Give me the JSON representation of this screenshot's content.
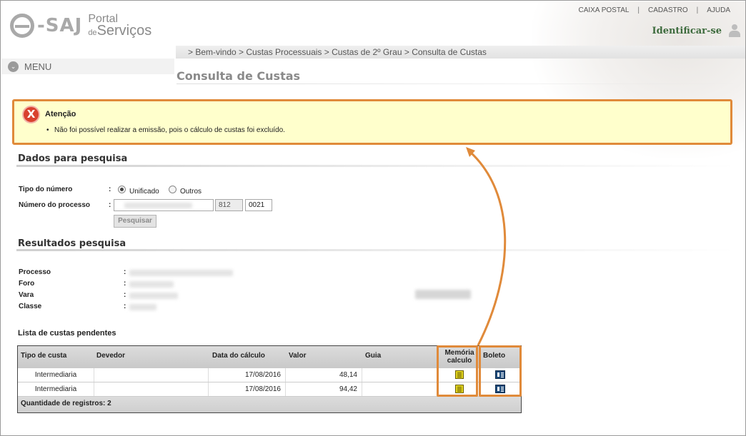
{
  "header": {
    "logo_saj": "-SAJ",
    "logo_portal": "Portal",
    "logo_de": "de",
    "logo_servicos": "Serviços",
    "top_links": [
      "CAIXA POSTAL",
      "CADASTRO",
      "AJUDA"
    ],
    "identify": "Identificar-se"
  },
  "nav": {
    "breadcrumb": "> Bem-vindo > Custas Processuais > Custas de 2º Grau > Consulta de Custas",
    "menu": "MENU",
    "page_title": "Consulta de Custas"
  },
  "alert": {
    "title": "Atenção",
    "message": "Não foi possível realizar a emissão, pois o cálculo de custas foi excluído."
  },
  "search": {
    "section_title": "Dados para pesquisa",
    "tipo_label": "Tipo do número",
    "colon": ":",
    "option_unificado": "Unificado",
    "option_outros": "Outros",
    "selected": "Unificado",
    "numero_label": "Número do processo",
    "field_812": "812",
    "field_0021": "0021",
    "button": "Pesquisar"
  },
  "results": {
    "section_title": "Resultados pesquisa",
    "labels": [
      "Processo",
      "Foro",
      "Vara",
      "Classe"
    ]
  },
  "list": {
    "title": "Lista de custas pendentes",
    "headers": {
      "tipo": "Tipo de custa",
      "devedor": "Devedor",
      "data": "Data do cálculo",
      "valor": "Valor",
      "guia": "Guia",
      "memoria_1": "Memória",
      "memoria_2": "calculo",
      "boleto": "Boleto"
    },
    "rows": [
      {
        "tipo": "Intermediaria",
        "devedor": "",
        "data": "17/08/2016",
        "valor": "48,14",
        "guia": ""
      },
      {
        "tipo": "Intermediaria",
        "devedor": "",
        "data": "17/08/2016",
        "valor": "94,42",
        "guia": ""
      }
    ],
    "footer": "Quantidade de registros: 2"
  },
  "colors": {
    "highlight": "#e08a3a",
    "alert_bg": "#ffffcc",
    "error_icon": "#d9412f",
    "identify": "#3d6b3d"
  }
}
